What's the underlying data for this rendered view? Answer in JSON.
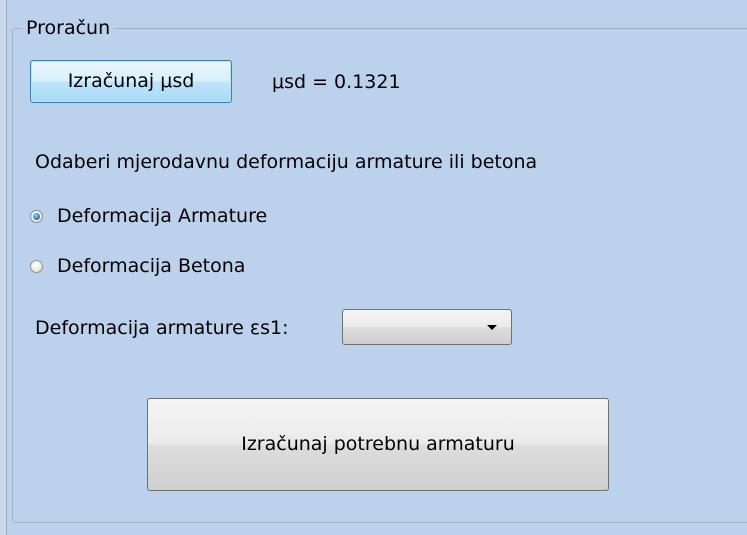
{
  "group": {
    "title": "Proračun"
  },
  "mu": {
    "button_label": "Izračunaj μsd",
    "value_text": "μsd = 0.1321"
  },
  "instruction": "Odaberi mjerodavnu deformaciju armature ili betona",
  "options": [
    {
      "label": "Deformacija Armature",
      "checked": true
    },
    {
      "label": "Deformacija Betona",
      "checked": false
    }
  ],
  "deformation": {
    "label": "Deformacija armature εs1:",
    "selected": ""
  },
  "calculate": {
    "button_label": "Izračunaj potrebnu armaturu"
  }
}
